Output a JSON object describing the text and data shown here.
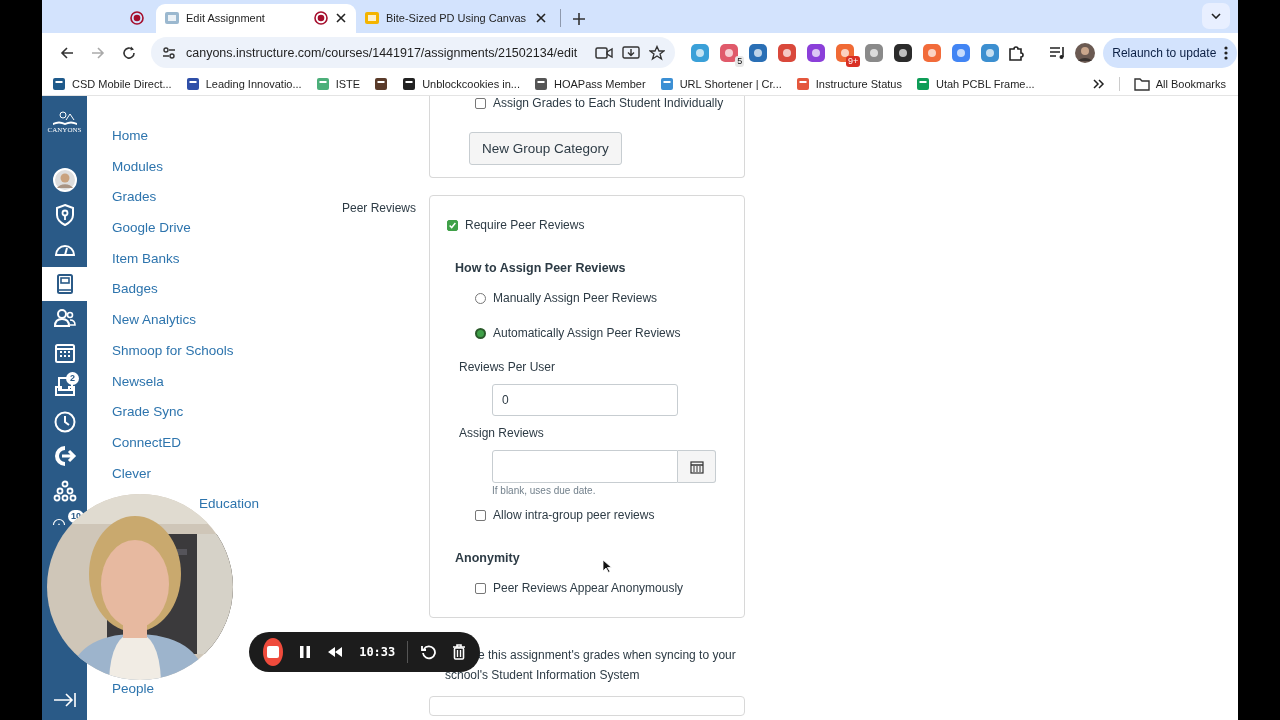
{
  "browser": {
    "tabs": [
      {
        "kind": "pinned",
        "selected": false
      },
      {
        "kind": "recording",
        "title": "Edit Assignment",
        "color": "#9bb8cf",
        "selected": true
      },
      {
        "kind": "page",
        "title": "Bite-Sized PD Using Canvas",
        "color": "#f4b400",
        "selected": false
      }
    ],
    "url": "canyons.instructure.com/courses/1441917/assignments/21502134/edit",
    "forward_disabled": true,
    "extensions": [
      {
        "color": "#3aa0d8"
      },
      {
        "color": "#e05a6a",
        "badge": "5"
      },
      {
        "color": "#2a6fb5"
      },
      {
        "color": "#d9483b"
      },
      {
        "color": "#8b3fd9"
      },
      {
        "color": "#f06a35",
        "badge": "9+"
      },
      {
        "color": "#8a8a8a"
      },
      {
        "color": "#2b2b2b"
      },
      {
        "color": "#f26b3a"
      },
      {
        "color": "#4285f4"
      },
      {
        "color": "#3c8fd0"
      }
    ],
    "relaunch_button": "Relaunch to update",
    "bookmarks": [
      {
        "label": "CSD Mobile Direct...",
        "color": "#1f5a8b"
      },
      {
        "label": "Leading Innovatio...",
        "color": "#2f4fa8"
      },
      {
        "label": "ISTE",
        "color": "#4caf7a"
      },
      {
        "color": "#5a3b2a"
      },
      {
        "label": "Unblockcookies in...",
        "color": "#222222"
      },
      {
        "label": "HOAPass Member",
        "color": "#555555"
      },
      {
        "label": "URL Shortener | Cr...",
        "color": "#3b8fd4"
      },
      {
        "label": "Instructure Status",
        "color": "#e4573d"
      },
      {
        "label": "Utah PCBL Frame...",
        "color": "#0f9d58"
      }
    ],
    "all_bookmarks": "All Bookmarks"
  },
  "global_nav": {
    "logo": [
      "CANYONS"
    ],
    "items": [
      {
        "kind": "account",
        "selected": false
      },
      {
        "kind": "admin",
        "selected": false
      },
      {
        "kind": "dashboard",
        "selected": false
      },
      {
        "kind": "courses",
        "selected": true
      },
      {
        "kind": "groups",
        "selected": false
      },
      {
        "kind": "calendar",
        "selected": false
      },
      {
        "kind": "inbox",
        "selected": false,
        "badge": "2"
      },
      {
        "kind": "history",
        "selected": false
      },
      {
        "kind": "commons",
        "selected": false
      },
      {
        "kind": "network",
        "selected": false
      },
      {
        "kind": "help",
        "selected": false,
        "badge": "10"
      }
    ]
  },
  "course_nav": [
    "Home",
    "Modules",
    "Grades",
    "Google Drive",
    "Item Banks",
    "Badges",
    "New Analytics",
    "Shmoop for Schools",
    "Newsela",
    "Grade Sync",
    "ConnectED",
    "Clever",
    "Education",
    "People"
  ],
  "form": {
    "group_options": {
      "checkbox": {
        "label": "Assign Grades to Each Student Individually",
        "checked": false
      },
      "button": "New Group Category"
    },
    "peer_reviews": {
      "label": "Peer Reviews",
      "require": {
        "label": "Require Peer Reviews",
        "checked": true
      },
      "assign_heading": "How to Assign Peer Reviews",
      "methods": [
        {
          "label": "Manually Assign Peer Reviews",
          "selected": false
        },
        {
          "label": "Automatically Assign Peer Reviews",
          "selected": true
        }
      ],
      "reviews_per_user": {
        "label": "Reviews Per User",
        "value": "0"
      },
      "assign_reviews": {
        "label": "Assign Reviews",
        "hint": "If blank, uses due date."
      },
      "intra_group": {
        "label": "Allow intra-group peer reviews",
        "checked": false
      },
      "anonymity_heading": "Anonymity",
      "anonymous": {
        "label": "Peer Reviews Appear Anonymously",
        "checked": false
      }
    },
    "sis_note": [
      "e this assignment's grades when syncing to your",
      "school's Student Information System"
    ]
  },
  "recorder": {
    "time": "10:33"
  }
}
